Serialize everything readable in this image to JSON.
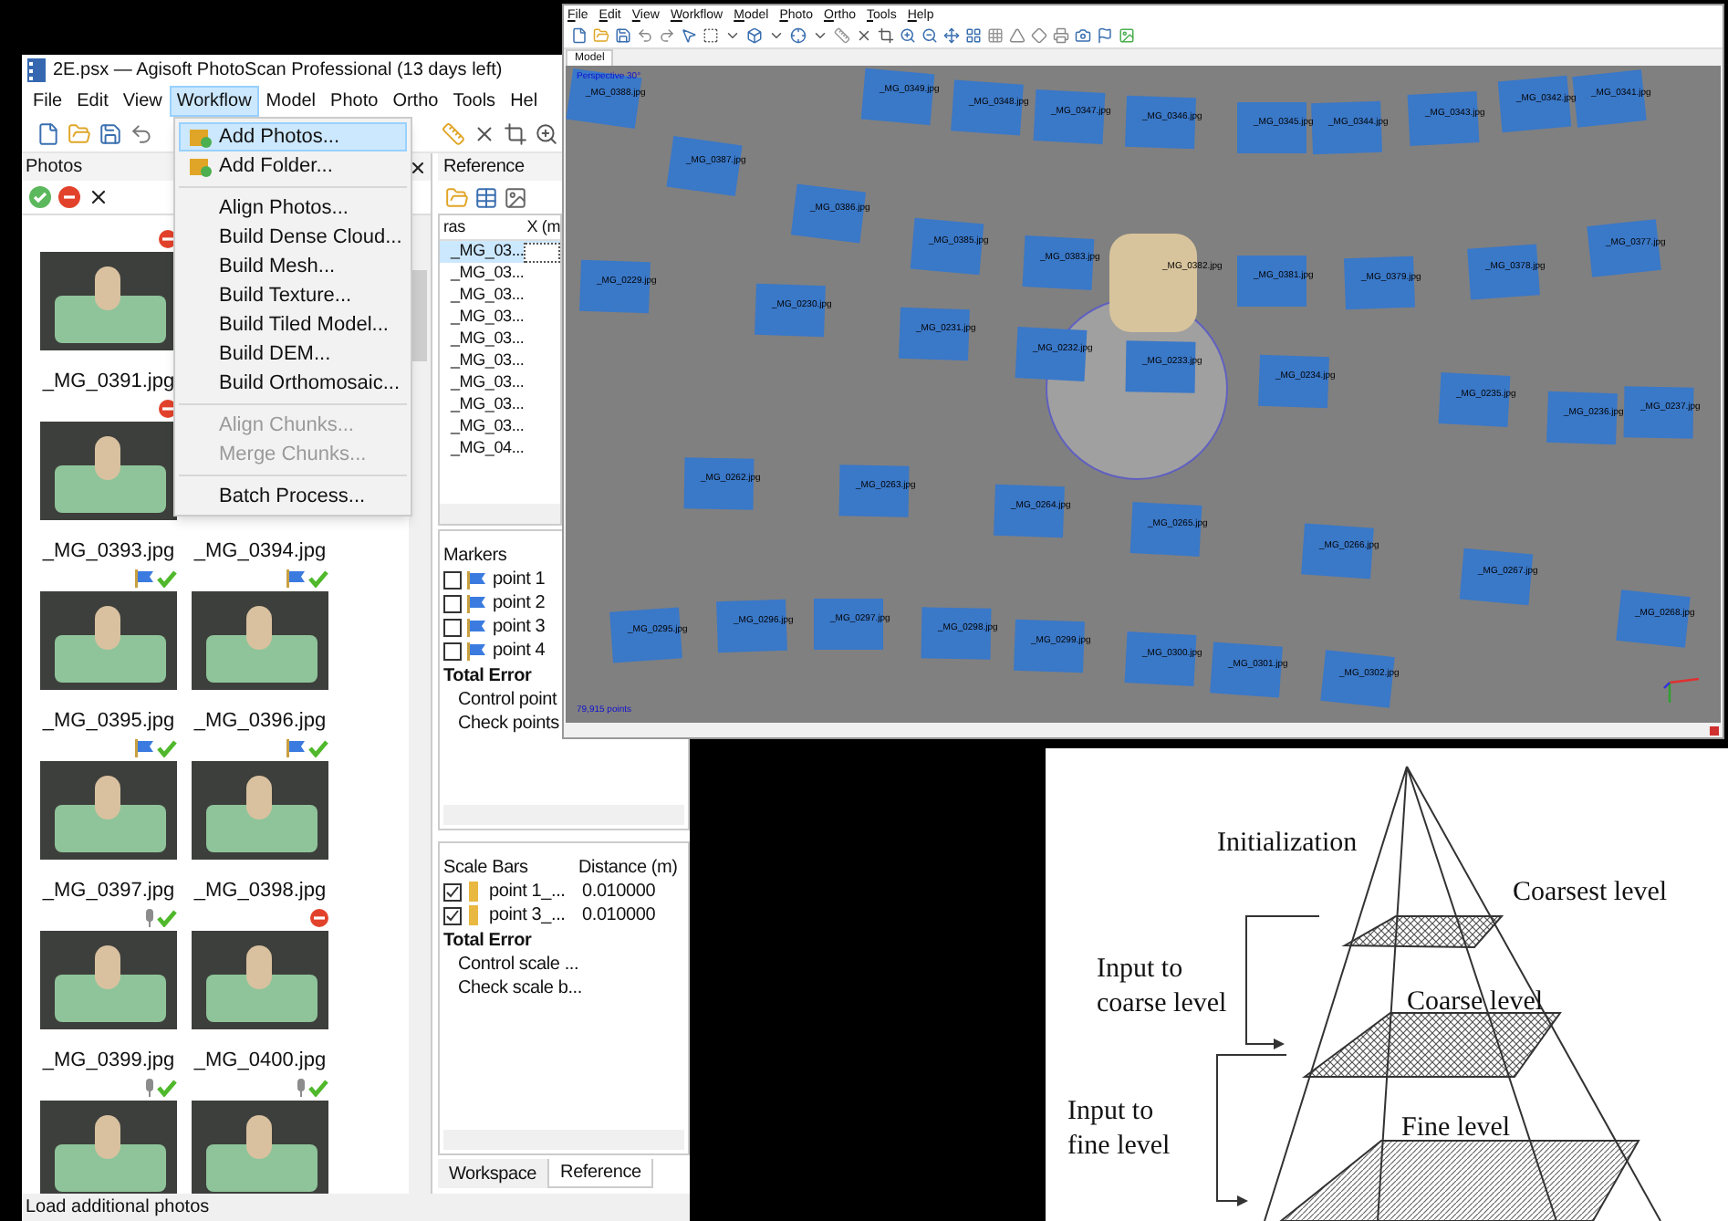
{
  "main_window": {
    "title": "2E.psx — Agisoft PhotoScan Professional (13 days left)",
    "menu": [
      {
        "label": "File",
        "selected": false
      },
      {
        "label": "Edit",
        "selected": false
      },
      {
        "label": "View",
        "selected": false
      },
      {
        "label": "Workflow",
        "selected": true
      },
      {
        "label": "Model",
        "selected": false
      },
      {
        "label": "Photo",
        "selected": false
      },
      {
        "label": "Ortho",
        "selected": false
      },
      {
        "label": "Tools",
        "selected": false
      },
      {
        "label": "Hel",
        "selected": false
      }
    ],
    "workflow_menu": [
      {
        "kind": "icon-item",
        "label": "Add Photos...",
        "selected": true,
        "disabled": false
      },
      {
        "kind": "icon-item",
        "label": "Add Folder...",
        "selected": false,
        "disabled": false
      },
      {
        "kind": "separator"
      },
      {
        "kind": "item",
        "label": "Align Photos...",
        "selected": false,
        "disabled": false
      },
      {
        "kind": "item",
        "label": "Build Dense Cloud...",
        "selected": false,
        "disabled": false
      },
      {
        "kind": "item",
        "label": "Build Mesh...",
        "selected": false,
        "disabled": false
      },
      {
        "kind": "item",
        "label": "Build Texture...",
        "selected": false,
        "disabled": false
      },
      {
        "kind": "item",
        "label": "Build Tiled Model...",
        "selected": false,
        "disabled": false
      },
      {
        "kind": "item",
        "label": "Build DEM...",
        "selected": false,
        "disabled": false
      },
      {
        "kind": "item",
        "label": "Build Orthomosaic...",
        "selected": false,
        "disabled": false
      },
      {
        "kind": "separator"
      },
      {
        "kind": "item",
        "label": "Align Chunks...",
        "selected": false,
        "disabled": true
      },
      {
        "kind": "item",
        "label": "Merge Chunks...",
        "selected": false,
        "disabled": true
      },
      {
        "kind": "separator"
      },
      {
        "kind": "item",
        "label": "Batch Process...",
        "selected": false,
        "disabled": false
      }
    ],
    "photos": {
      "title": "Photos",
      "rows": [
        {
          "cells": [
            {
              "kind": "photo",
              "label": "_MG_0391.jpg",
              "rejected": true
            },
            {
              "kind": "blank"
            }
          ]
        },
        {
          "cells": [
            {
              "kind": "photo",
              "label": "_MG_0393.jpg",
              "rejected": true
            },
            {
              "kind": "caption",
              "label": "_MG_0394.jpg"
            }
          ]
        },
        {
          "cells": [
            {
              "kind": "photo",
              "label": "_MG_0395.jpg",
              "rejected": false,
              "has_markers": true
            },
            {
              "kind": "photo",
              "label": "_MG_0396.jpg",
              "rejected": false,
              "has_markers": true
            }
          ]
        },
        {
          "cells": [
            {
              "kind": "photo",
              "label": "_MG_0397.jpg",
              "rejected": false,
              "has_markers": true
            },
            {
              "kind": "photo",
              "label": "_MG_0398.jpg",
              "rejected": false,
              "has_markers": true
            }
          ]
        },
        {
          "cells": [
            {
              "kind": "photo",
              "label": "_MG_0399.jpg",
              "rejected": false,
              "has_markers": false
            },
            {
              "kind": "photo",
              "label": "_MG_0400.jpg",
              "rejected": true
            }
          ]
        },
        {
          "cells": [
            {
              "kind": "photo",
              "rejected": false,
              "has_markers": false
            },
            {
              "kind": "photo",
              "rejected": false,
              "has_markers": false
            }
          ]
        }
      ]
    },
    "reference": {
      "title": "Reference",
      "columns": [
        "ras",
        "X (m"
      ],
      "rows": [
        {
          "label": "_MG_03...",
          "selected": true
        },
        {
          "label": "_MG_03...",
          "selected": false
        },
        {
          "label": "_MG_03...",
          "selected": false
        },
        {
          "label": "_MG_03...",
          "selected": false
        },
        {
          "label": "_MG_03...",
          "selected": false
        },
        {
          "label": "_MG_03...",
          "selected": false
        },
        {
          "label": "_MG_03...",
          "selected": false
        },
        {
          "label": "_MG_03...",
          "selected": false
        },
        {
          "label": "_MG_03...",
          "selected": false
        },
        {
          "label": "_MG_04...",
          "selected": false
        }
      ],
      "markers": {
        "title": "Markers",
        "items": [
          {
            "label": "point 1",
            "checked": false
          },
          {
            "label": "point 2",
            "checked": false
          },
          {
            "label": "point 3",
            "checked": false
          },
          {
            "label": "point 4",
            "checked": false
          }
        ],
        "total": "Total Error",
        "sub_items": [
          "Control point",
          "Check points"
        ]
      },
      "scale_bars": {
        "columns": [
          "Scale Bars",
          "Distance (m)"
        ],
        "items": [
          {
            "label": "point 1_...",
            "value": "0.010000",
            "checked": true
          },
          {
            "label": "point 3_...",
            "value": "0.010000",
            "checked": true
          }
        ],
        "total": "Total Error",
        "sub_items": [
          "Control scale ...",
          "Check scale b..."
        ]
      },
      "tabs": [
        {
          "label": "Workspace",
          "selected": false
        },
        {
          "label": "Reference",
          "selected": true
        }
      ]
    },
    "status_bar": "Load additional photos"
  },
  "model_window": {
    "menu": [
      "File",
      "Edit",
      "View",
      "Workflow",
      "Model",
      "Photo",
      "Ortho",
      "Tools",
      "Help"
    ],
    "tabs": [
      {
        "label": "Model",
        "selected": true
      }
    ],
    "projection": "Perspective 30°",
    "point_count": "79,915 points",
    "cameras": [
      "_MG_0388.jpg",
      "_MG_0349.jpg",
      "_MG_0348.jpg",
      "_MG_0347.jpg",
      "_MG_0346.jpg",
      "_MG_0345.jpg",
      "_MG_0344.jpg",
      "_MG_0343.jpg",
      "_MG_0342.jpg",
      "_MG_0341.jpg",
      "_MG_0387.jpg",
      "_MG_0386.jpg",
      "_MG_0385.jpg",
      "_MG_0383.jpg",
      "_MG_0382.jpg",
      "_MG_0381.jpg",
      "_MG_0379.jpg",
      "_MG_0378.jpg",
      "_MG_0377.jpg",
      "_MG_0229.jpg",
      "_MG_0230.jpg",
      "_MG_0231.jpg",
      "_MG_0232.jpg",
      "_MG_0233.jpg",
      "_MG_0234.jpg",
      "_MG_0235.jpg",
      "_MG_0236.jpg",
      "_MG_0237.jpg",
      "_MG_0262.jpg",
      "_MG_0263.jpg",
      "_MG_0264.jpg",
      "_MG_0265.jpg",
      "_MG_0266.jpg",
      "_MG_0267.jpg",
      "_MG_0268.jpg",
      "_MG_0295.jpg",
      "_MG_0296.jpg",
      "_MG_0297.jpg",
      "_MG_0298.jpg",
      "_MG_0299.jpg",
      "_MG_0300.jpg",
      "_MG_0301.jpg",
      "_MG_0302.jpg"
    ]
  },
  "diagram": {
    "labels": [
      "Initialization",
      "Coarsest level",
      "Input to coarse level",
      "Coarse level",
      "Input to fine level",
      "Fine level"
    ]
  }
}
